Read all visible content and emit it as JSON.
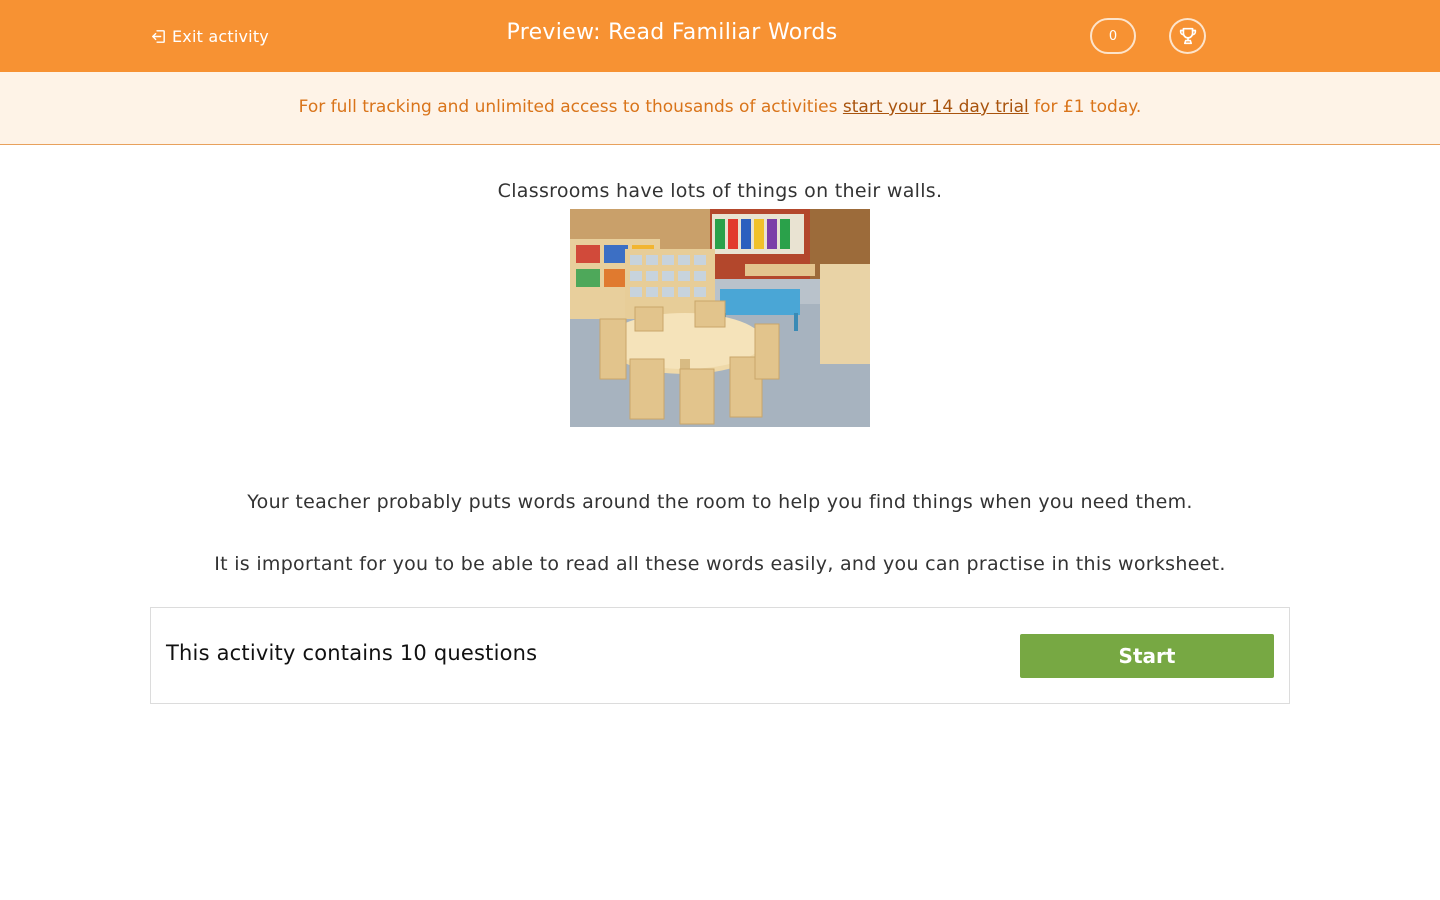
{
  "header": {
    "exit_label": "Exit activity",
    "title": "Preview: Read Familiar Words",
    "score": "0"
  },
  "banner": {
    "text_before": "For full tracking and unlimited access to thousands of activities ",
    "link_text": "start your 14 day trial",
    "text_after": " for £1 today."
  },
  "content": {
    "intro": "Classrooms have lots of things on their walls.",
    "paragraph_1": "Your teacher probably puts words around the room to help you find things when you need them.",
    "paragraph_2": "It is important for you to be able to read all these words easily, and you can practise in this worksheet."
  },
  "panel": {
    "question_count_text": "This activity contains 10 questions",
    "start_label": "Start"
  },
  "colors": {
    "header": "#f79233",
    "banner_bg": "#fef3e7",
    "start_button": "#77a843"
  },
  "icons": {
    "exit": "exit-icon",
    "trophy": "trophy-icon"
  }
}
